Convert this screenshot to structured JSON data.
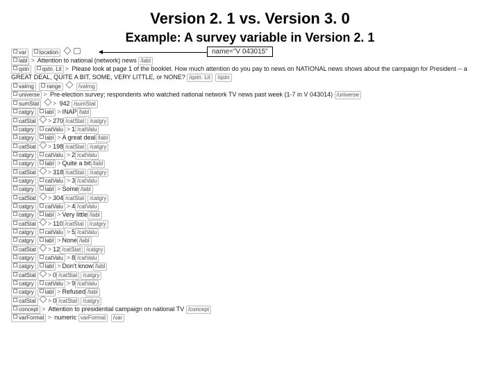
{
  "title": "Version 2. 1 vs. Version 3. 0",
  "subtitle": "Example: A survey variable in Version 2. 1",
  "callout": "name=\"V 043015\"",
  "tags": {
    "var": "var",
    "location": "location",
    "labl": "labl",
    "labl_close": "/labl",
    "qstn": "qstn",
    "qstnLit": "qstn. Lit",
    "qstnLit_close": "/qstn. Lit",
    "qstn_close": "/qstn",
    "valrng": "valrng",
    "range": "range",
    "valrng_close": "/valrng",
    "universe": "universe",
    "universe_close": "/universe",
    "sumStat": "sumStat",
    "sumStat_close": "/sumStat",
    "catgry": "catgry",
    "catgry_close": "/catgry",
    "catStat": "catStat",
    "catStat_close": "/catStat",
    "catValu": "catValu",
    "catValu_close": "/catValu",
    "concept": "concept",
    "concept_close": "/concept",
    "varFormat": "varFormat",
    "var_close": "/var"
  },
  "text": {
    "attention_label": "Attention to national (network) news",
    "question": "Please look at page 1 of the booklet. How much attention do you pay to news on NATIONAL news shows about the campaign for President -- a GREAT DEAL, QUITE A BIT, SOME, VERY LITTLE, or NONE?",
    "universe": "Pre-election survey; respondents who watched national network TV news past week (1-7 in V 043014)",
    "concept": "Attention to presidential campaign on national TV",
    "varFormat": "numeric"
  },
  "stats": {
    "sum": "942",
    "cats": [
      {
        "label": "INAP",
        "stat": "270",
        "val": "1"
      },
      {
        "label": "A great deal",
        "stat": "198",
        "val": "2"
      },
      {
        "label": "Quite a bit",
        "stat": "318",
        "val": "3"
      },
      {
        "label": "Some",
        "stat": "304",
        "val": "4"
      },
      {
        "label": "Very little",
        "stat": "110",
        "val": "5"
      },
      {
        "label": "None",
        "stat": "12",
        "val": "8"
      },
      {
        "label": "Don't know",
        "stat": "0",
        "val": "9"
      },
      {
        "label": "Refused",
        "stat": "0",
        "val": ""
      }
    ]
  }
}
